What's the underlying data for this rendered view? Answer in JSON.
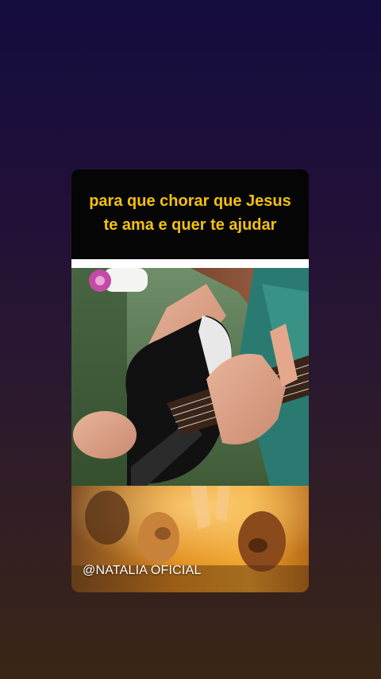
{
  "story": {
    "caption": "para que chorar que Jesus te ama e quer te ajudar",
    "watermark": "@NATALIA OFICIAL"
  },
  "colors": {
    "caption_text": "#f3c10c",
    "card_background": "#050505",
    "page_gradient_top": "#140c3e",
    "page_gradient_bottom": "#3a2616"
  },
  "media": {
    "top_image": "girl-playing-acoustic-guitar-photo",
    "bottom_image": "worship-crowd-raising-hands-photo"
  }
}
